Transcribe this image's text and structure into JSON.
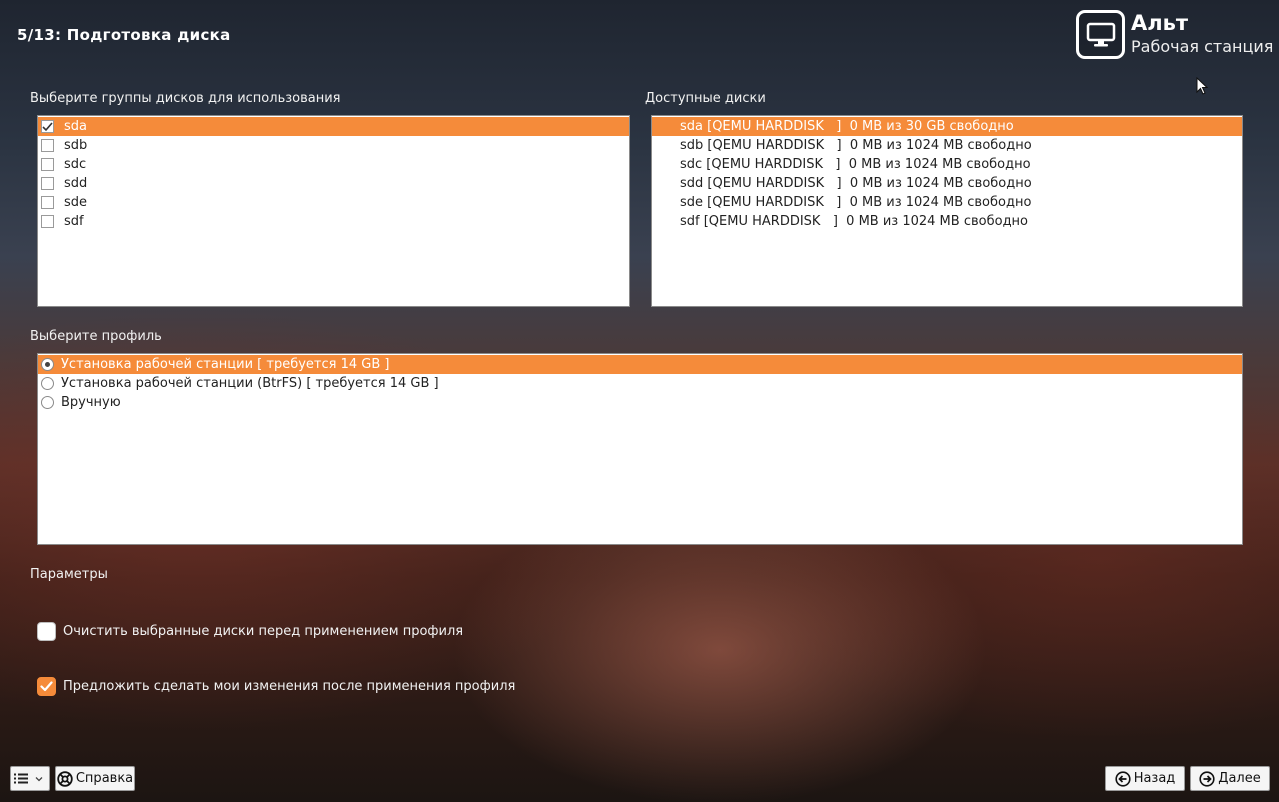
{
  "header": {
    "title": "5/13: Подготовка диска",
    "brand_name": "Альт",
    "brand_sub": "Рабочая станция"
  },
  "disk_groups": {
    "label": "Выберите группы дисков для использования",
    "items": [
      {
        "name": "sda",
        "checked": true,
        "selected": true
      },
      {
        "name": "sdb",
        "checked": false,
        "selected": false
      },
      {
        "name": "sdc",
        "checked": false,
        "selected": false
      },
      {
        "name": "sdd",
        "checked": false,
        "selected": false
      },
      {
        "name": "sde",
        "checked": false,
        "selected": false
      },
      {
        "name": "sdf",
        "checked": false,
        "selected": false
      }
    ]
  },
  "available_disks": {
    "label": "Доступные диски",
    "items": [
      "sda [QEMU HARDDISK   ]  0 MB из 30 GB свободно",
      "sdb [QEMU HARDDISK   ]  0 MB из 1024 MB свободно",
      "sdc [QEMU HARDDISK   ]  0 MB из 1024 MB свободно",
      "sdd [QEMU HARDDISK   ]  0 MB из 1024 MB свободно",
      "sde [QEMU HARDDISK   ]  0 MB из 1024 MB свободно",
      "sdf [QEMU HARDDISK   ]  0 MB из 1024 MB свободно"
    ]
  },
  "profiles": {
    "label": "Выберите профиль",
    "items": [
      {
        "name": "Установка рабочей станции [ требуется 14 GB ]",
        "selected": true
      },
      {
        "name": "Установка рабочей станции (BtrFS) [ требуется 14 GB ]",
        "selected": false
      },
      {
        "name": "Вручную",
        "selected": false
      }
    ]
  },
  "params": {
    "label": "Параметры",
    "clear_disks": {
      "label": "Очистить выбранные диски перед применением профиля",
      "checked": false
    },
    "suggest_changes": {
      "label": "Предложить сделать мои изменения после применения профиля",
      "checked": true
    }
  },
  "footer": {
    "help_label": "Справка",
    "back_label": "Назад",
    "next_label": "Далее"
  },
  "colors": {
    "accent": "#f58b3a"
  }
}
